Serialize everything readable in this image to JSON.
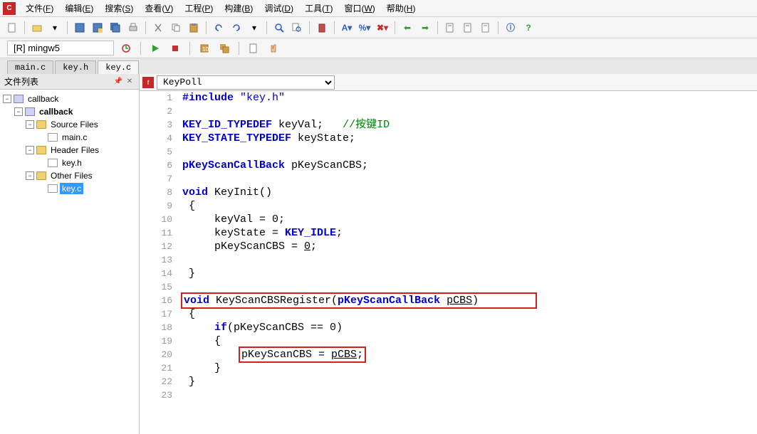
{
  "menu": {
    "items": [
      {
        "label": "文件",
        "key": "F"
      },
      {
        "label": "编辑",
        "key": "E"
      },
      {
        "label": "搜索",
        "key": "S"
      },
      {
        "label": "查看",
        "key": "V"
      },
      {
        "label": "工程",
        "key": "P"
      },
      {
        "label": "构建",
        "key": "B"
      },
      {
        "label": "调试",
        "key": "D"
      },
      {
        "label": "工具",
        "key": "T"
      },
      {
        "label": "窗口",
        "key": "W"
      },
      {
        "label": "帮助",
        "key": "H"
      }
    ]
  },
  "toolbar2": {
    "target": "[R] mingw5"
  },
  "file_tabs": {
    "items": [
      "main.c",
      "key.h",
      "key.c"
    ],
    "active": 2
  },
  "sidebar": {
    "title": "文件列表",
    "tree": {
      "root": "callback",
      "project": "callback",
      "folders": [
        {
          "name": "Source Files",
          "files": [
            "main.c"
          ]
        },
        {
          "name": "Header Files",
          "files": [
            "key.h"
          ]
        },
        {
          "name": "Other Files",
          "files": [
            "key.c"
          ],
          "selected": "key.c"
        }
      ]
    }
  },
  "editor": {
    "func_selector": "KeyPoll",
    "lines": [
      {
        "n": 1,
        "tokens": [
          [
            "kw",
            "#include"
          ],
          [
            "",
            " "
          ],
          [
            "str",
            "\"key.h\""
          ]
        ]
      },
      {
        "n": 2,
        "tokens": []
      },
      {
        "n": 3,
        "tokens": [
          [
            "kw",
            "KEY_ID_TYPEDEF"
          ],
          [
            "",
            " keyVal;   "
          ],
          [
            "cm",
            "//按键ID"
          ]
        ]
      },
      {
        "n": 4,
        "tokens": [
          [
            "kw",
            "KEY_STATE_TYPEDEF"
          ],
          [
            "",
            " keyState;"
          ]
        ]
      },
      {
        "n": 5,
        "tokens": []
      },
      {
        "n": 6,
        "tokens": [
          [
            "kw",
            "pKeyScanCallBack"
          ],
          [
            "",
            " pKeyScanCBS;"
          ]
        ]
      },
      {
        "n": 7,
        "tokens": []
      },
      {
        "n": 8,
        "tokens": [
          [
            "kw",
            "void"
          ],
          [
            "",
            " KeyInit()"
          ]
        ]
      },
      {
        "n": 9,
        "tokens": [
          [
            "",
            " {"
          ]
        ]
      },
      {
        "n": 10,
        "tokens": [
          [
            "",
            "     keyVal = 0;"
          ]
        ]
      },
      {
        "n": 11,
        "tokens": [
          [
            "",
            "     keyState = "
          ],
          [
            "kw",
            "KEY_IDLE"
          ],
          [
            "",
            ";"
          ]
        ]
      },
      {
        "n": 12,
        "tokens": [
          [
            "",
            "     pKeyScanCBS = "
          ],
          [
            "u",
            "0"
          ],
          [
            "",
            ";"
          ]
        ]
      },
      {
        "n": 13,
        "tokens": []
      },
      {
        "n": 14,
        "tokens": [
          [
            "",
            " }"
          ]
        ]
      },
      {
        "n": 15,
        "tokens": []
      },
      {
        "n": 16,
        "hl": true,
        "tokens": [
          [
            "kw",
            "void"
          ],
          [
            "",
            " KeyScanCBSRegister("
          ],
          [
            "kw",
            "pKeyScanCallBack"
          ],
          [
            "",
            " "
          ],
          [
            "u",
            "pCBS"
          ],
          [
            "",
            ")"
          ]
        ]
      },
      {
        "n": 17,
        "tokens": [
          [
            "",
            " {"
          ]
        ]
      },
      {
        "n": 18,
        "tokens": [
          [
            "",
            "     "
          ],
          [
            "kw",
            "if"
          ],
          [
            "",
            "(pKeyScanCBS == 0)"
          ]
        ]
      },
      {
        "n": 19,
        "tokens": [
          [
            "",
            "     {"
          ]
        ]
      },
      {
        "n": 20,
        "hl2": true,
        "tokens": [
          [
            "",
            "         pKeyScanCBS = "
          ],
          [
            "u",
            "pCBS"
          ],
          [
            "",
            ";"
          ]
        ]
      },
      {
        "n": 21,
        "tokens": [
          [
            "",
            "     }"
          ]
        ]
      },
      {
        "n": 22,
        "tokens": [
          [
            "",
            " }"
          ]
        ]
      },
      {
        "n": 23,
        "tokens": []
      }
    ]
  }
}
